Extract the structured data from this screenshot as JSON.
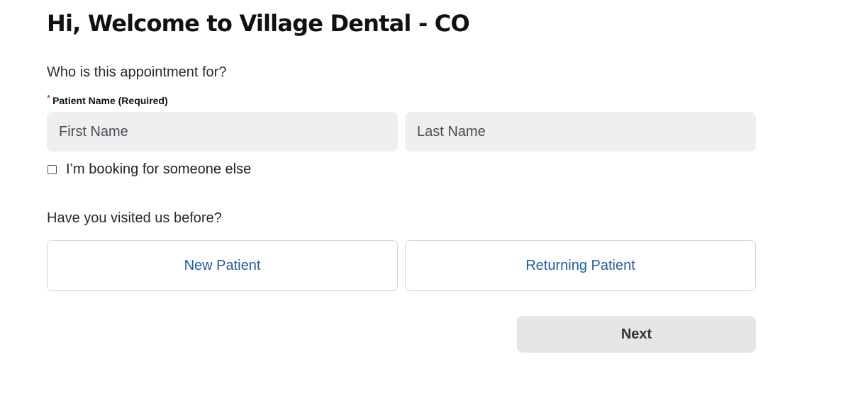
{
  "header": {
    "title": "Hi, Welcome to Village Dental - CO"
  },
  "appointment": {
    "question": "Who is this appointment for?",
    "required_marker": "*",
    "patient_name_label": "Patient Name (Required)",
    "first_name": {
      "value": "",
      "placeholder": "First Name"
    },
    "last_name": {
      "value": "",
      "placeholder": "Last Name"
    },
    "someone_else": {
      "label": "I’m booking for someone else",
      "checked": false
    }
  },
  "visit": {
    "question": "Have you visited us before?",
    "options": [
      {
        "label": "New Patient"
      },
      {
        "label": "Returning Patient"
      }
    ]
  },
  "actions": {
    "next_label": "Next"
  },
  "colors": {
    "link_text": "#1f5fa8",
    "required_star": "#d0021b",
    "input_bg": "#efefef",
    "next_bg": "#e6e6e6"
  }
}
